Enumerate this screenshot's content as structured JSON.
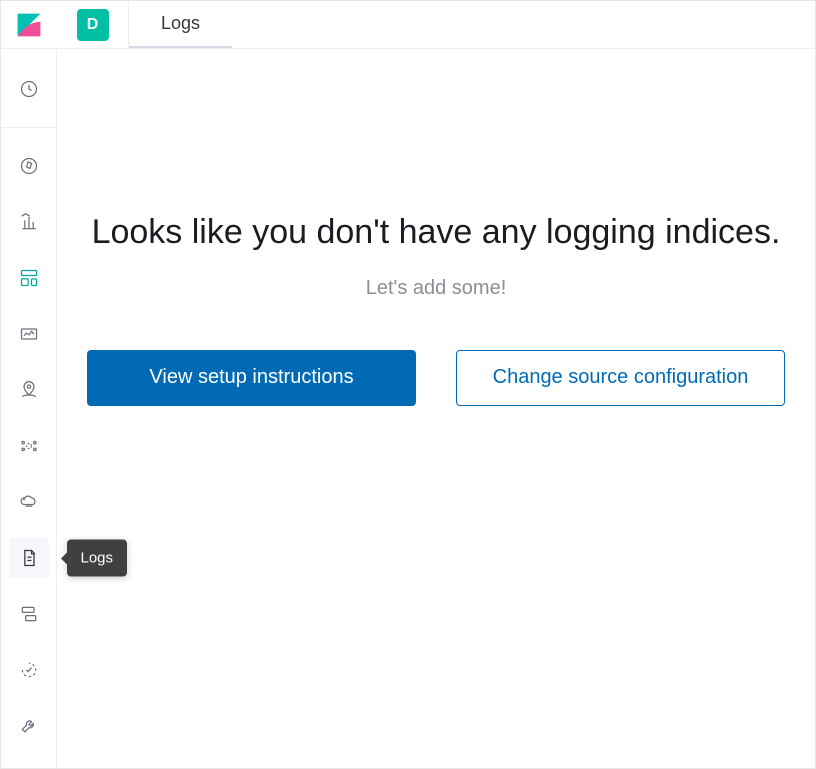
{
  "header": {
    "space_letter": "D",
    "tab_label": "Logs"
  },
  "sidebar": {
    "tooltip_label": "Logs"
  },
  "empty_state": {
    "title": "Looks like you don't have any logging indices.",
    "subtitle": "Let's add some!",
    "primary_button": "View setup instructions",
    "secondary_button": "Change source configuration"
  }
}
